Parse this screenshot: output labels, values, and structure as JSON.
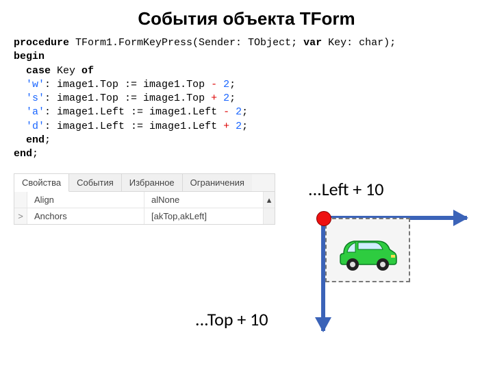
{
  "title": "События объекта TForm",
  "code": {
    "kw_procedure": "procedure",
    "proc_name": " TForm1.FormKeyPress(Sender: TObject; ",
    "kw_var": "var",
    "params_tail": " Key: char);",
    "kw_begin": "begin",
    "kw_case": "case",
    "case_mid": " Key ",
    "kw_of": "of",
    "s_w": "'w'",
    "l_w_a": ": image1.Top := image1.Top ",
    "op_minus1": "-",
    "sp_val1": " ",
    "n2_1": "2",
    "semi1": ";",
    "s_s": "'s'",
    "l_s_a": ": image1.Top := image1.Top ",
    "op_plus1": "+",
    "sp_val2": " ",
    "n2_2": "2",
    "semi2": ";",
    "s_a": "'a'",
    "l_a_a": ": image1.Left := image1.Left ",
    "op_minus2": "-",
    "sp_val3": " ",
    "n2_3": "2",
    "semi3": ";",
    "s_d": "'d'",
    "l_d_a": ": image1.Left := image1.Left ",
    "op_plus2": "+",
    "sp_val4": " ",
    "n2_4": "2",
    "semi4": ";",
    "kw_end1": "end",
    "semi5": ";",
    "kw_end2": "end",
    "semi6": ";"
  },
  "inspector": {
    "tabs": {
      "props": "Свойства",
      "events": "События",
      "fav": "Избранное",
      "restr": "Ограничения"
    },
    "rows": [
      {
        "gutter": "",
        "name": "Align",
        "value": "alNone"
      },
      {
        "gutter": ">",
        "name": "Anchors",
        "value": "[akTop,akLeft]"
      }
    ],
    "scroll_glyph": "▴"
  },
  "labels": {
    "left": "...Left + 10",
    "top": "...Top + 10"
  }
}
